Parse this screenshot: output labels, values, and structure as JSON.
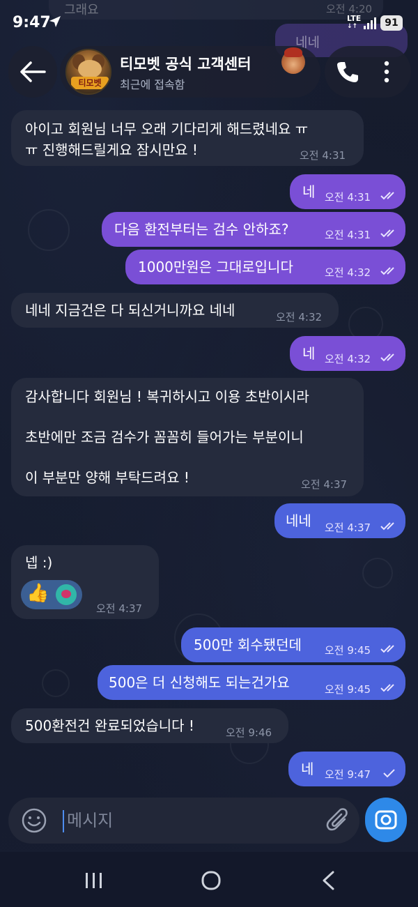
{
  "status_bar": {
    "time": "9:47",
    "network": "LTE",
    "battery": "91"
  },
  "ghost_messages": {
    "incoming_text": "그래요",
    "incoming_time": "오전 4:20",
    "outgoing_text": "네네"
  },
  "header": {
    "chat_title": "티모벳 공식 고객센터",
    "subtitle": "최근에 접속함",
    "avatar_logo": "티모벳",
    "icons": [
      "back-arrow-icon",
      "phone-icon",
      "more-vertical-icon"
    ]
  },
  "messages": [
    {
      "direction": "in",
      "lines": [
        "아이고 회원님 너무 오래 기다리게 해드렸네요 ㅠ",
        "ㅠ 진행해드릴게요 잠시만요 !"
      ],
      "time": "오전 4:31"
    },
    {
      "direction": "out",
      "lines": [
        "네"
      ],
      "time": "오전 4:31",
      "read": true
    },
    {
      "direction": "out",
      "lines": [
        "다음 환전부터는 검수 안하죠?"
      ],
      "time": "오전 4:31",
      "read": true
    },
    {
      "direction": "out",
      "lines": [
        "1000만원은 그대로입니다"
      ],
      "time": "오전 4:32",
      "read": true
    },
    {
      "direction": "in",
      "lines": [
        "네네 지금건은 다 되신거니까요 네네"
      ],
      "time": "오전 4:32"
    },
    {
      "direction": "out",
      "lines": [
        "네"
      ],
      "time": "오전 4:32",
      "read": true
    },
    {
      "direction": "in",
      "lines": [
        "감사합니다 회원님 ! 복귀하시고 이용 초반이시라",
        "초반에만 조금 검수가 꼼꼼히 들어가는 부분이니",
        "이 부분만 양해 부탁드려요 !"
      ],
      "time": "오전 4:37"
    },
    {
      "direction": "out",
      "lines": [
        "네네"
      ],
      "time": "오전 4:37",
      "read": true
    },
    {
      "direction": "in",
      "lines": [
        "넵 :)"
      ],
      "time": "오전 4:37",
      "reactions": [
        "thumbs-up",
        "blob-sticker"
      ]
    },
    {
      "direction": "out",
      "lines": [
        "500만 회수됐던데"
      ],
      "time": "오전 9:45",
      "read": true
    },
    {
      "direction": "out",
      "lines": [
        "500은 더 신청해도 되는건가요"
      ],
      "time": "오전 9:45",
      "read": true
    },
    {
      "direction": "in",
      "lines": [
        "500환전건 완료되었습니다 !"
      ],
      "time": "오전 9:46"
    },
    {
      "direction": "out",
      "lines": [
        "네"
      ],
      "time": "오전 9:47",
      "read": false
    }
  ],
  "composer": {
    "placeholder": "메시지"
  },
  "colors": {
    "background": "#141a2c",
    "incoming_bubble": "#252b3d",
    "outgoing_bubble_purple": "#7a4fd6",
    "outgoing_bubble_blue": "#4d63dd",
    "accent": "#2e89e8"
  }
}
